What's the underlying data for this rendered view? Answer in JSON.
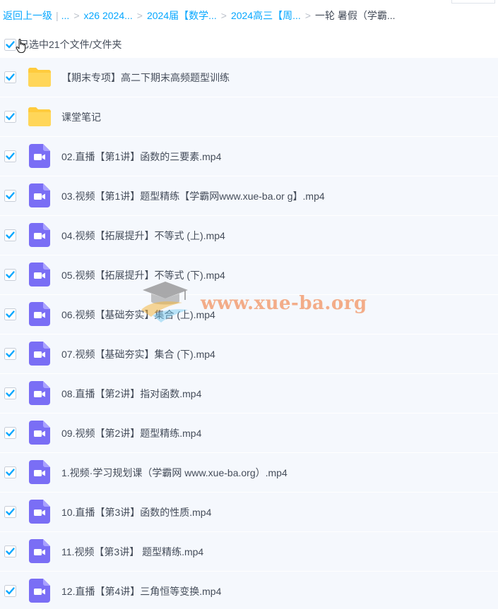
{
  "breadcrumb": {
    "back_label": "返回上一级",
    "ellipsis": "...",
    "items": [
      {
        "label": "x26 2024..."
      },
      {
        "label": "2024届【数学..."
      },
      {
        "label": "2024高三【周..."
      },
      {
        "label": "一轮 暑假（学霸..."
      }
    ],
    "separator": ">"
  },
  "selection": {
    "summary": "已选中21个文件/文件夹",
    "checked": true
  },
  "files": [
    {
      "name": "【期末专项】高二下期末高频题型训练",
      "type": "folder",
      "checked": true
    },
    {
      "name": "课堂笔记",
      "type": "folder",
      "checked": true
    },
    {
      "name": "02.直播【第1讲】函数的三要素.mp4",
      "type": "video",
      "checked": true
    },
    {
      "name": "03.视频【第1讲】题型精练【学霸网www.xue-ba.or g】.mp4",
      "type": "video",
      "checked": true
    },
    {
      "name": "04.视频【拓展提升】不等式 (上).mp4",
      "type": "video",
      "checked": true
    },
    {
      "name": "05.视频【拓展提升】不等式 (下).mp4",
      "type": "video",
      "checked": true
    },
    {
      "name": "06.视频【基础夯实】集合 (上).mp4",
      "type": "video",
      "checked": true
    },
    {
      "name": "07.视频【基础夯实】集合 (下).mp4",
      "type": "video",
      "checked": true
    },
    {
      "name": "08.直播【第2讲】指对函数.mp4",
      "type": "video",
      "checked": true
    },
    {
      "name": "09.视频【第2讲】题型精练.mp4",
      "type": "video",
      "checked": true
    },
    {
      "name": "1.视频·学习规划课（学霸网 www.xue-ba.org）.mp4",
      "type": "video",
      "checked": true
    },
    {
      "name": "10.直播【第3讲】函数的性质.mp4",
      "type": "video",
      "checked": true
    },
    {
      "name": "11.视频【第3讲】 题型精练.mp4",
      "type": "video",
      "checked": true
    },
    {
      "name": "12.直播【第4讲】三角恒等变换.mp4",
      "type": "video",
      "checked": true
    }
  ],
  "watermark": {
    "text": "www.xue-ba.org"
  },
  "colors": {
    "link": "#06a7ff",
    "checkbox": "#06a7ff",
    "row_bg": "#f5f8fd",
    "folder": "#ffd659",
    "video": "#7a6ef5",
    "text": "#454d5a"
  }
}
